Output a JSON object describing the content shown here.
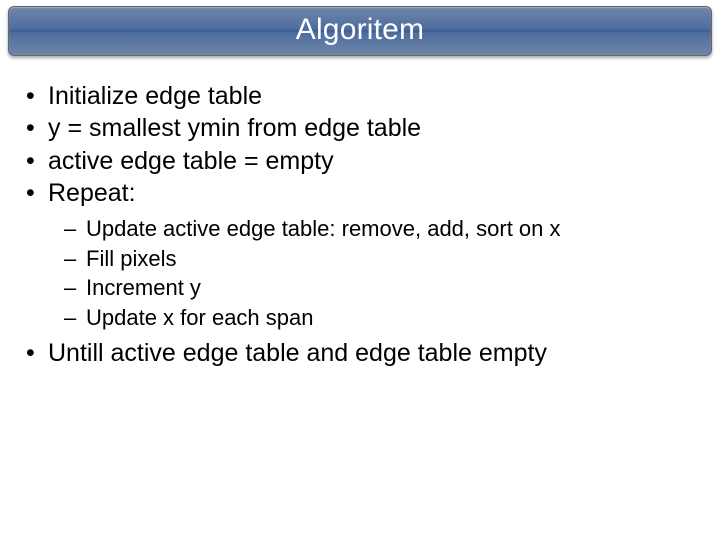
{
  "title": "Algoritem",
  "bullets": {
    "b1": "Initialize edge table",
    "b2": "y = smallest ymin from edge table",
    "b3": "active edge table = empty",
    "b4": "Repeat:",
    "sub": {
      "s1": "Update active edge table: remove, add, sort on x",
      "s2": "Fill pixels",
      "s3": "Increment y",
      "s4": "Update x for each span"
    },
    "b5": "Untill active edge table and edge table empty"
  }
}
